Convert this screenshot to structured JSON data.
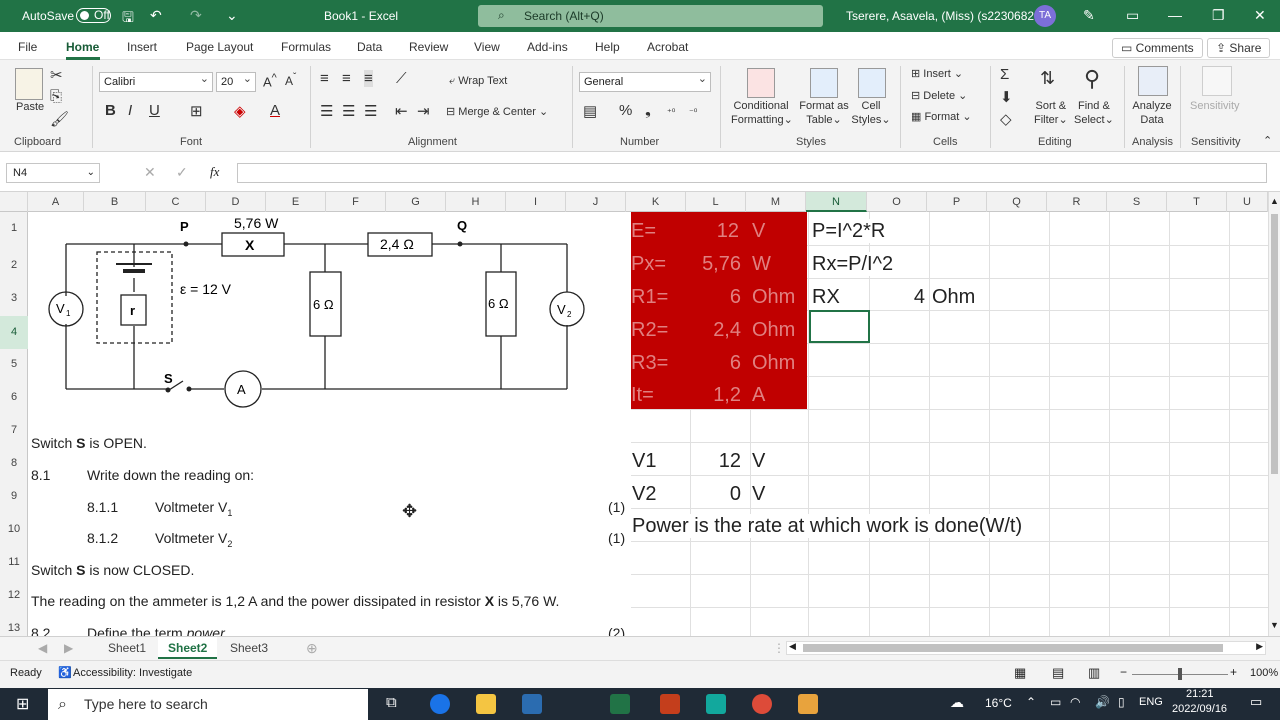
{
  "titlebar": {
    "autosave_label": "AutoSave",
    "autosave_state": "Off",
    "filename": "Book1 - Excel",
    "search_placeholder": "Search (Alt+Q)",
    "user": "Tserere, Asavela, (Miss) (s223068268)",
    "user_initials": "TA"
  },
  "menu": {
    "items": [
      "File",
      "Home",
      "Insert",
      "Page Layout",
      "Formulas",
      "Data",
      "Review",
      "View",
      "Add-ins",
      "Help",
      "Acrobat"
    ],
    "comments": "Comments",
    "share": "Share"
  },
  "ribbon": {
    "clipboard": {
      "label": "Clipboard",
      "paste": "Paste"
    },
    "font": {
      "label": "Font",
      "name": "Calibri",
      "size": "20"
    },
    "alignment": {
      "label": "Alignment",
      "wrap": "Wrap Text",
      "merge": "Merge & Center"
    },
    "number": {
      "label": "Number",
      "format": "General"
    },
    "styles": {
      "label": "Styles",
      "cond1": "Conditional",
      "cond2": "Formatting",
      "fmt1": "Format as",
      "fmt2": "Table",
      "cell1": "Cell",
      "cell2": "Styles"
    },
    "cells": {
      "label": "Cells",
      "insert": "Insert",
      "delete": "Delete",
      "format": "Format"
    },
    "editing": {
      "label": "Editing",
      "sort1": "Sort &",
      "sort2": "Filter",
      "find1": "Find &",
      "find2": "Select"
    },
    "analysis": {
      "label": "Analysis",
      "analyze1": "Analyze",
      "analyze2": "Data"
    },
    "sensitivity": {
      "label": "Sensitivity",
      "btn": "Sensitivity"
    }
  },
  "formula_bar": {
    "namebox": "N4",
    "fx": "fx",
    "value": ""
  },
  "columns": [
    "A",
    "B",
    "C",
    "D",
    "E",
    "F",
    "G",
    "H",
    "I",
    "J",
    "K",
    "L",
    "M",
    "N",
    "O",
    "P",
    "Q",
    "R",
    "S",
    "T",
    "U"
  ],
  "rows": [
    "1",
    "2",
    "3",
    "4",
    "5",
    "6",
    "7",
    "8",
    "9",
    "10",
    "11",
    "12",
    "13"
  ],
  "circuit": {
    "label_p": "P",
    "label_q": "Q",
    "x_power": "5,76 W",
    "x_label": "X",
    "r2": "2,4 Ω",
    "emf": "ε = 12 V",
    "r_internal": "r",
    "r6a": "6 Ω",
    "r6b": "6 Ω",
    "v1": "V",
    "v1_sub": "1",
    "v2": "V",
    "v2_sub": "2",
    "switch": "S",
    "ammeter": "A"
  },
  "question": {
    "line1_pre": "Switch ",
    "line1_b": "S",
    "line1_post": " is OPEN.",
    "q81_num": "8.1",
    "q81_text": "Write down the reading on:",
    "q811_num": "8.1.1",
    "q811_text": "Voltmeter V",
    "q811_sub": "1",
    "q811_marks": "(1)",
    "q812_num": "8.1.2",
    "q812_text": "Voltmeter V",
    "q812_sub": "2",
    "q812_marks": "(1)",
    "line2_pre": "Switch ",
    "line2_b": "S",
    "line2_post": " is now CLOSED.",
    "line3_pre": "The reading on the ammeter is 1,2 A and the power dissipated in resistor ",
    "line3_b": "X",
    "line3_post": " is 5,76 W.",
    "q82_num": "8.2",
    "q82_text": "Define the term ",
    "q82_italic": "power",
    "q82_marks": "(2)"
  },
  "sheet_cells": {
    "k1": "E=",
    "l1": "12",
    "m1": "V",
    "k2": "Px=",
    "l2": "5,76",
    "m2": "W",
    "k3": "R1=",
    "l3": "6",
    "m3": "Ohm",
    "k4": "R2=",
    "l4": "2,4",
    "m4": "Ohm",
    "k5": "R3=",
    "l5": "6",
    "m5": "Ohm",
    "k6": "It=",
    "l6": "1,2",
    "m6": "A",
    "n1": "P=I^2*R",
    "n2": "Rx=P/I^2",
    "n3": "RX",
    "o3": "4",
    "p3": "Ohm",
    "k8": "V1",
    "l8": "12",
    "m8": "V",
    "k9": "V2",
    "l9": "0",
    "m9": "V",
    "k10": "Power is the rate at which work is done(W/t)"
  },
  "sheets": [
    "Sheet1",
    "Sheet2",
    "Sheet3"
  ],
  "status": {
    "ready": "Ready",
    "accessibility": "Accessibility: Investigate",
    "zoom": "100%"
  },
  "taskbar": {
    "search": "Type here to search",
    "temp": "16°C",
    "lang": "ENG",
    "time": "21:21",
    "date": "2022/09/16"
  },
  "colors": {
    "excel_green": "#217346",
    "red_fill": "#c00000"
  }
}
